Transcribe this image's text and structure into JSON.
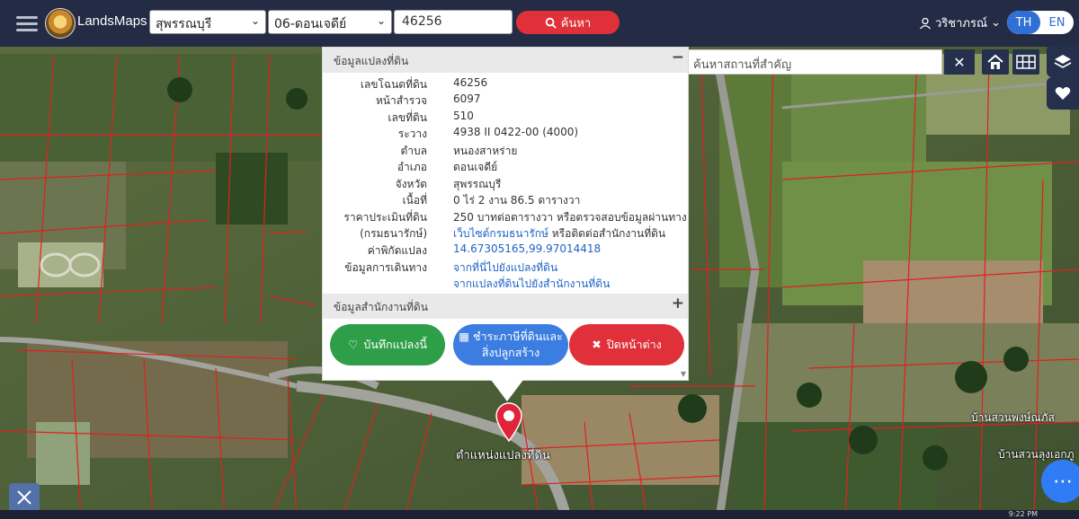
{
  "topbar": {
    "brand": "LandsMaps",
    "province": "สุพรรณบุรี",
    "district": "06-ดอนเจดีย์",
    "parcel_number": "46256",
    "search_label": "ค้นหา",
    "user_name": "วริชาภรณ์",
    "lang_th": "TH",
    "lang_en": "EN"
  },
  "landmark_search": {
    "placeholder": "ค้นหาสถานที่สำคัญ"
  },
  "popup": {
    "section1_title": "ข้อมูลแปลงที่ดิน",
    "section1_toggle": "−",
    "rows": [
      {
        "label": "เลขโฉนดที่ดิน",
        "value": "46256"
      },
      {
        "label": "หน้าสำรวจ",
        "value": "6097"
      },
      {
        "label": "เลขที่ดิน",
        "value": "510"
      },
      {
        "label": "ระวาง",
        "value": "4938 II 0422-00 (4000)"
      },
      {
        "label": "ตำบล",
        "value": "หนองสาหร่าย"
      },
      {
        "label": "อำเภอ",
        "value": "ดอนเจดีย์"
      },
      {
        "label": "จังหวัด",
        "value": "สุพรรณบุรี"
      },
      {
        "label": "เนื้อที่",
        "value": "0 ไร่ 2 งาน 86.5 ตารางวา"
      }
    ],
    "price_label": "ราคาประเมินที่ดิน",
    "price_label2": "(กรมธนารักษ์)",
    "price_value": "250 บาทต่อตารางวา หรือตรวจสอบข้อมูลผ่านทาง",
    "price_link": "เว็บไซต์กรมธนารักษ์",
    "price_suffix": " หรือติดต่อสำนักงานที่ดิน",
    "coord_label": "ค่าพิกัดแปลง",
    "coord_value": "14.67305165,99.97014418",
    "route_label": "ข้อมูลการเดินทาง",
    "route_link1": "จากที่นี่ไปยังแปลงที่ดิน",
    "route_link2": "จากแปลงที่ดินไปยังสำนักงานที่ดิน",
    "section2_title": "ข้อมูลสำนักงานที่ดิน",
    "section2_toggle": "+",
    "btn_save": "บันทึกแปลงนี้",
    "btn_pay_1": "ชำระภาษีที่ดินและ",
    "btn_pay_2": "สิ่งปลูกสร้าง",
    "btn_close": "ปิดหน้าต่าง"
  },
  "map": {
    "marker_label": "ตำแหน่งแปลงที่ดิน",
    "place_1": "บ้านสวนพงษ์ณภัส",
    "place_2": "บ้านสวนลุงเอกภู"
  },
  "taskbar": {
    "time": "9:22 PM"
  },
  "colors": {
    "topbar": "#232b45",
    "accent_red": "#e0313b",
    "accent_blue": "#2f6fd6",
    "green": "#2e9e48",
    "parcel_line": "#e02020"
  }
}
